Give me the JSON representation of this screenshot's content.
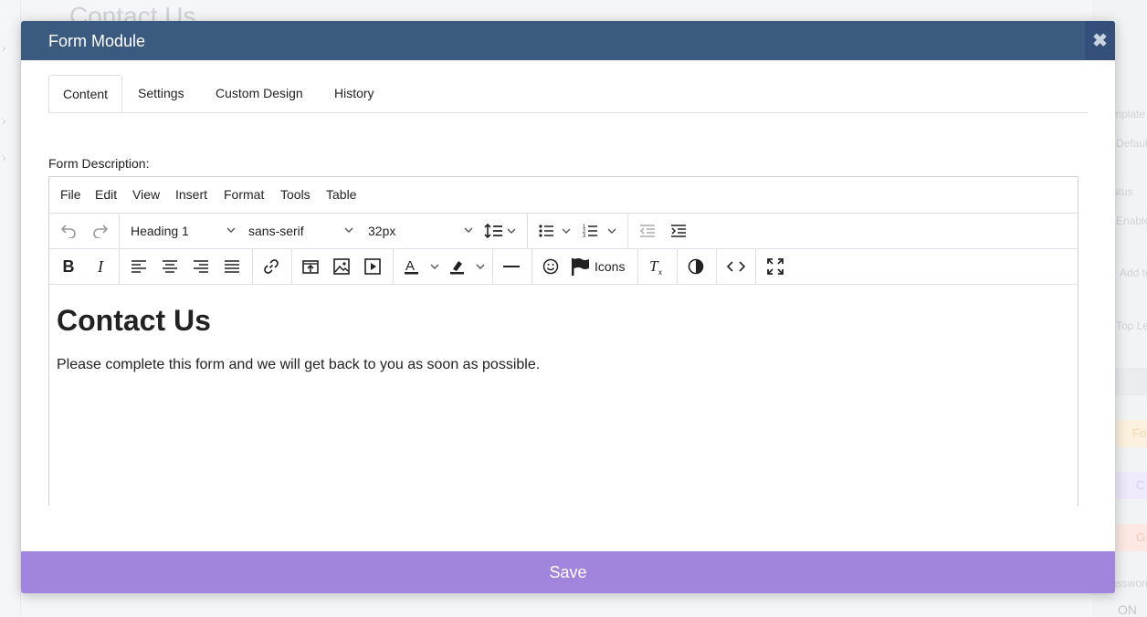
{
  "background": {
    "page_title": "Contact Us",
    "right_labels": [
      "mplate",
      "Defaul",
      "atus",
      "Enable",
      "Add to",
      "Top Le",
      "Fo",
      "C",
      "G",
      "assword"
    ],
    "toggle_value": "ON"
  },
  "modal": {
    "title": "Form Module",
    "close_glyph": "✖",
    "tabs": [
      {
        "label": "Content"
      },
      {
        "label": "Settings"
      },
      {
        "label": "Custom Design"
      },
      {
        "label": "History"
      }
    ],
    "description_label": "Form Description:",
    "save_label": "Save"
  },
  "editor": {
    "menu": [
      "File",
      "Edit",
      "View",
      "Insert",
      "Format",
      "Tools",
      "Table"
    ],
    "block_format": "Heading 1",
    "font_family": "sans-serif",
    "font_size": "32px",
    "icons_label": "Icons",
    "content": {
      "heading": "Contact Us",
      "paragraph": "Please complete this form and we will get back to you as soon as possible."
    }
  },
  "colors": {
    "header": "#3b5a80",
    "save": "#a184dc"
  }
}
